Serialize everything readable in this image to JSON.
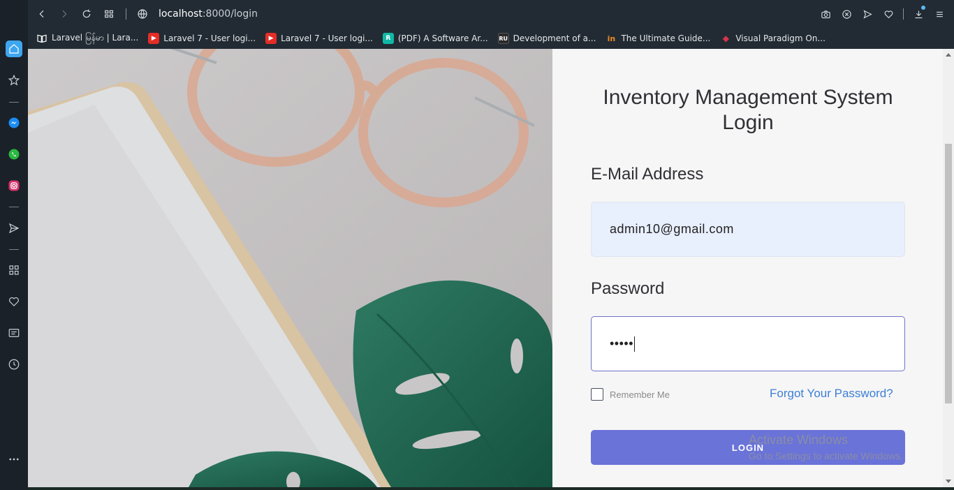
{
  "browser": {
    "url_host": "localhost",
    "url_path": ":8000/login",
    "bookmarks": [
      {
        "label": "Laravel မြန်မာ | Lara...",
        "fav_text": "",
        "fav_color": "#ffffff"
      },
      {
        "label": "Laravel 7 - User logi...",
        "fav_text": "▶",
        "fav_color": "#e52d27"
      },
      {
        "label": "Laravel 7 - User logi...",
        "fav_text": "▶",
        "fav_color": "#e52d27"
      },
      {
        "label": "(PDF) A Software Ar...",
        "fav_text": "R",
        "fav_color": "#10b8a6"
      },
      {
        "label": "Development of a...",
        "fav_text": "RU",
        "fav_color": "#2b2b2b"
      },
      {
        "label": "The Ultimate Guide...",
        "fav_text": "in",
        "fav_color": "#f08a24"
      },
      {
        "label": "Visual Paradigm On...",
        "fav_text": "◆",
        "fav_color": "#d8344d"
      }
    ],
    "sidebar_icons": [
      "home-icon",
      "bookmarks-star-icon",
      "messenger-icon",
      "whatsapp-icon",
      "instagram-icon",
      "send-icon",
      "apps-icon",
      "heart-icon",
      "notes-icon",
      "history-icon",
      "more-icon"
    ],
    "toolbar_icons": [
      "camera-icon",
      "block-icon",
      "send-icon",
      "heart-icon",
      "download-icon",
      "menu-icon"
    ]
  },
  "login": {
    "title": "Inventory Management System Login",
    "email_label": "E-Mail Address",
    "email_value": "admin10@gmail.com",
    "password_label": "Password",
    "password_value": "•••••",
    "remember_label": "Remember Me",
    "forgot_label": "Forgot Your Password?",
    "button_label": "LOGIN"
  },
  "watermark": {
    "line1": "Activate Windows",
    "line2": "Go to Settings to activate Windows."
  }
}
